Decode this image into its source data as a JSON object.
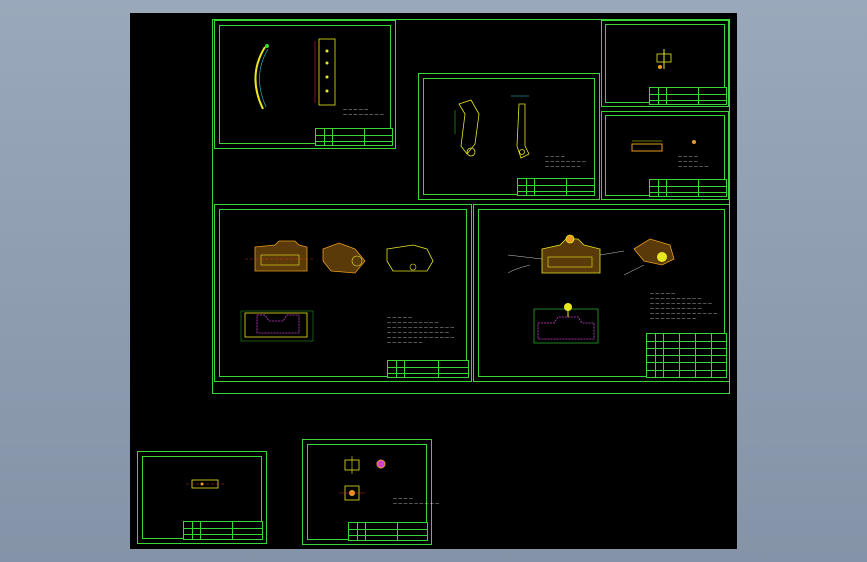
{
  "window": {
    "title": ""
  },
  "colors": {
    "background": "#8c9cb0",
    "canvas": "#000000",
    "border": "#39d639",
    "part_yellow": "#e8e820",
    "part_orange": "#e89b20",
    "part_magenta": "#d040d0",
    "dimension_cyan": "#30d0e0",
    "text": "#ffffff"
  },
  "sheets": [
    {
      "id": "sheet-1",
      "title_block": "",
      "note": ""
    },
    {
      "id": "sheet-2",
      "title_block": "",
      "note": ""
    },
    {
      "id": "sheet-3",
      "title_block": "",
      "note": ""
    },
    {
      "id": "sheet-4",
      "title_block": "",
      "note": ""
    },
    {
      "id": "sheet-5",
      "title_block": "",
      "note": ""
    },
    {
      "id": "sheet-6",
      "title_block": "",
      "note": ""
    },
    {
      "id": "sheet-7",
      "title_block": "",
      "note": ""
    },
    {
      "id": "sheet-8",
      "title_block": "",
      "note": ""
    }
  ]
}
